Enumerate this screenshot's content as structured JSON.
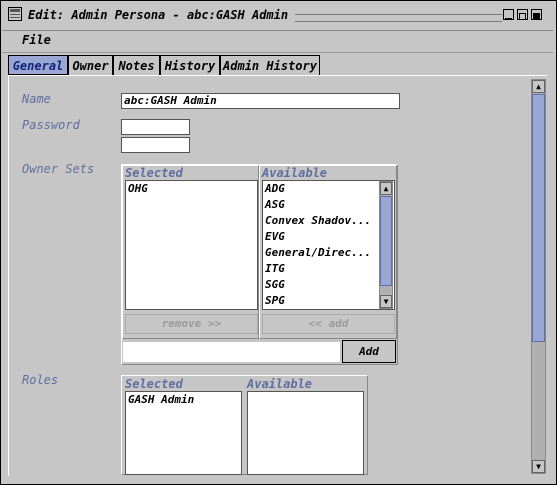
{
  "window": {
    "title": "Edit: Admin Persona - abc:GASH Admin"
  },
  "menu": {
    "file": "File"
  },
  "tabs": [
    {
      "label": "General",
      "active": true
    },
    {
      "label": "Owner"
    },
    {
      "label": "Notes"
    },
    {
      "label": "History"
    },
    {
      "label": "Admin History"
    }
  ],
  "form": {
    "name_label": "Name",
    "name_value": "abc:GASH Admin",
    "password_label": "Password",
    "password_value": "",
    "password_confirm": "",
    "owner_sets_label": "Owner Sets",
    "roles_label": "Roles"
  },
  "owner_sets": {
    "selected_header": "Selected",
    "available_header": "Available",
    "selected_items": [
      "OHG"
    ],
    "available_items": [
      "ADG",
      "ASG",
      "Convex Shadov...",
      "EVG",
      "General/Direc...",
      "ITG",
      "SGG",
      "SPG"
    ],
    "remove_label": "remove >>",
    "add_label": "<< add",
    "add_button": "Add",
    "add_input": ""
  },
  "roles": {
    "selected_header": "Selected",
    "available_header": "Available",
    "selected_items": [
      "GASH Admin"
    ]
  },
  "colors": {
    "tab_active": "#9aa7d4",
    "label": "#5f6e9f"
  }
}
